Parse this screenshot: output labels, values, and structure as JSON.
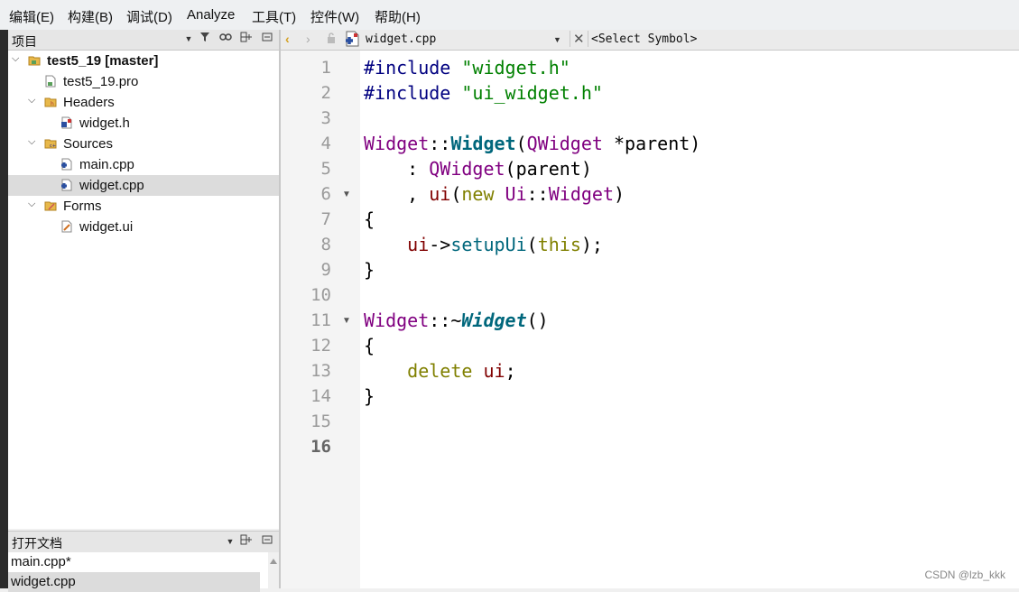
{
  "menu": [
    "编辑(E)",
    "构建(B)",
    "调试(D)",
    "Analyze",
    "工具(T)",
    "控件(W)",
    "帮助(H)"
  ],
  "project_panel": {
    "title": "项目",
    "tree": [
      {
        "label": "test5_19 [master]",
        "bold": true,
        "expanded": true,
        "icon": "project-folder-icon"
      },
      {
        "label": "test5_19.pro",
        "icon": "pro-file-icon"
      },
      {
        "label": "Headers",
        "expanded": true,
        "icon": "headers-folder-icon"
      },
      {
        "label": "widget.h",
        "icon": "header-file-icon"
      },
      {
        "label": "Sources",
        "expanded": true,
        "icon": "sources-folder-icon"
      },
      {
        "label": "main.cpp",
        "icon": "cpp-file-icon"
      },
      {
        "label": "widget.cpp",
        "icon": "cpp-file-icon",
        "selected": true
      },
      {
        "label": "Forms",
        "expanded": true,
        "icon": "forms-folder-icon"
      },
      {
        "label": "widget.ui",
        "icon": "ui-file-icon"
      }
    ]
  },
  "open_docs": {
    "title": "打开文档",
    "items": [
      "main.cpp*",
      "widget.cpp"
    ]
  },
  "editor": {
    "filename": "widget.cpp",
    "symbol": "<Select Symbol>",
    "current_line": "16",
    "line_numbers": [
      "1",
      "2",
      "3",
      "4",
      "5",
      "6",
      "7",
      "8",
      "9",
      "10",
      "11",
      "12",
      "13",
      "14",
      "15",
      "16"
    ],
    "code": {
      "l1a": "#include ",
      "l1b": "\"widget.h\"",
      "l2a": "#include ",
      "l2b": "\"ui_widget.h\"",
      "l4a": "Widget",
      "l4b": "::",
      "l4c": "Widget",
      "l4d": "(",
      "l4e": "QWidget",
      "l4f": " *",
      "l4g": "parent",
      "l4h": ")",
      "l5a": "    : ",
      "l5b": "QWidget",
      "l5c": "(",
      "l5d": "parent",
      "l5e": ")",
      "l6a": "    , ",
      "l6b": "ui",
      "l6c": "(",
      "l6d": "new",
      "l6e": " Ui",
      "l6f": "::",
      "l6g": "Widget",
      "l6h": ")",
      "l7": "{",
      "l8a": "    ",
      "l8b": "ui",
      "l8c": "->",
      "l8d": "setupUi",
      "l8e": "(",
      "l8f": "this",
      "l8g": ");",
      "l9": "}",
      "l11a": "Widget",
      "l11b": "::~",
      "l11c": "Widget",
      "l11d": "()",
      "l12": "{",
      "l13a": "    ",
      "l13b": "delete",
      "l13c": " ",
      "l13d": "ui",
      "l13e": ";",
      "l14": "}"
    }
  },
  "watermark": "CSDN @lzb_kkk",
  "colors": {
    "keyword": "#808000",
    "string": "#008000",
    "class": "#800080",
    "function": "#00677c",
    "preprocessor": "#000080"
  }
}
